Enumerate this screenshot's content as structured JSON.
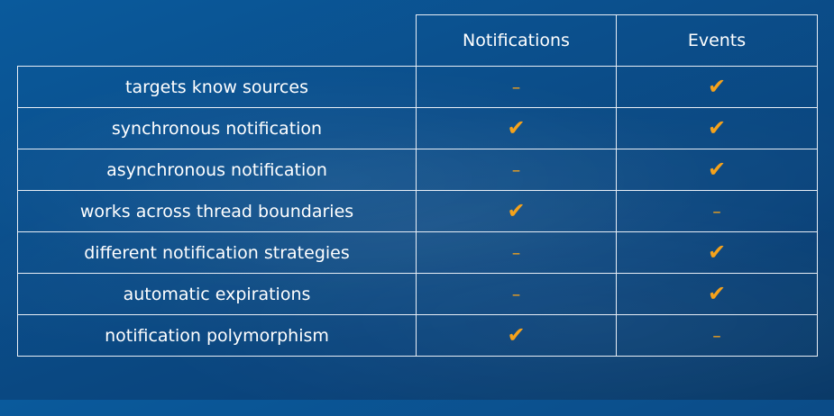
{
  "table": {
    "headers": [
      "Notifications",
      "Events"
    ],
    "rows": [
      {
        "feature": "targets know sources",
        "notifications": "–",
        "events": "✔"
      },
      {
        "feature": "synchronous notification",
        "notifications": "✔",
        "events": "✔"
      },
      {
        "feature": "asynchronous notification",
        "notifications": "–",
        "events": "✔"
      },
      {
        "feature": "works across thread boundaries",
        "notifications": "✔",
        "events": "–"
      },
      {
        "feature": "different notification strategies",
        "notifications": "–",
        "events": "✔"
      },
      {
        "feature": "automatic expirations",
        "notifications": "–",
        "events": "✔"
      },
      {
        "feature": "notification polymorphism",
        "notifications": "✔",
        "events": "–"
      }
    ]
  },
  "colors": {
    "background": "#0b4f8c",
    "mark": "#f5a21b",
    "text": "#ffffff",
    "grid": "#e8eef6"
  },
  "icons": {
    "yes": "check-icon",
    "no": "dash-icon"
  }
}
